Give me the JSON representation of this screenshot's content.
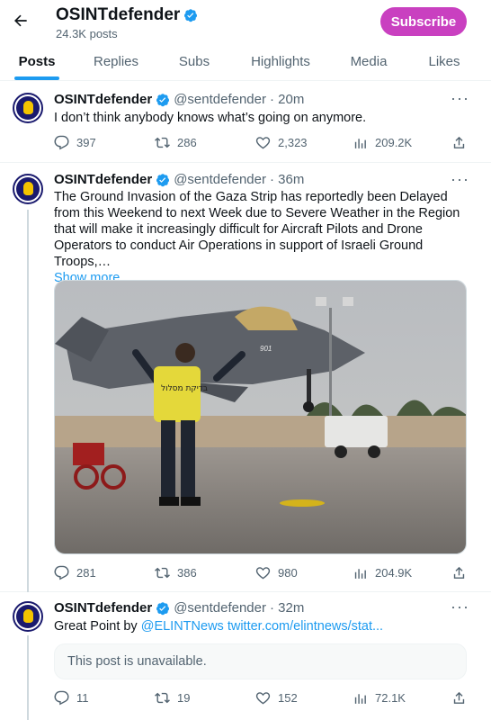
{
  "header": {
    "title": "OSINTdefender",
    "post_count": "24.3K posts",
    "subscribe_label": "Subscribe"
  },
  "tabs": [
    {
      "label": "Posts",
      "active": true
    },
    {
      "label": "Replies",
      "active": false
    },
    {
      "label": "Subs",
      "active": false
    },
    {
      "label": "Highlights",
      "active": false
    },
    {
      "label": "Media",
      "active": false
    },
    {
      "label": "Likes",
      "active": false
    }
  ],
  "posts": [
    {
      "author": "OSINTdefender",
      "handle": "@sentdefender",
      "time": "· 20m",
      "text": "I don’t think anybody knows what’s going on anymore.",
      "replies": "397",
      "reposts": "286",
      "likes": "2,323",
      "views": "209.2K"
    },
    {
      "author": "OSINTdefender",
      "handle": "@sentdefender",
      "time": "· 36m",
      "text": "The Ground Invasion of the Gaza Strip has reportedly been Delayed from this Weekend to next Week due to Severe Weather in the Region that will make it increasingly difficult for Aircraft Pilots and Drone Operators to conduct Air Operations in support of Israeli Ground Troops,…",
      "show_more": "Show more",
      "media_vest_text": "בדיקת מסלול",
      "media_tail_number": "901",
      "replies": "281",
      "reposts": "386",
      "likes": "980",
      "views": "204.9K"
    },
    {
      "author": "OSINTdefender",
      "handle": "@sentdefender",
      "time": "· 32m",
      "text_prefix": "Great Point by ",
      "mention": "@ELINTNews",
      "link": "twitter.com/elintnews/stat...",
      "unavailable": "This post is unavailable.",
      "replies": "11",
      "reposts": "19",
      "likes": "152",
      "views": "72.1K"
    }
  ],
  "colors": {
    "accent": "#1d9bf0",
    "subscribe": "#c940c0",
    "secondary_text": "#536471"
  }
}
